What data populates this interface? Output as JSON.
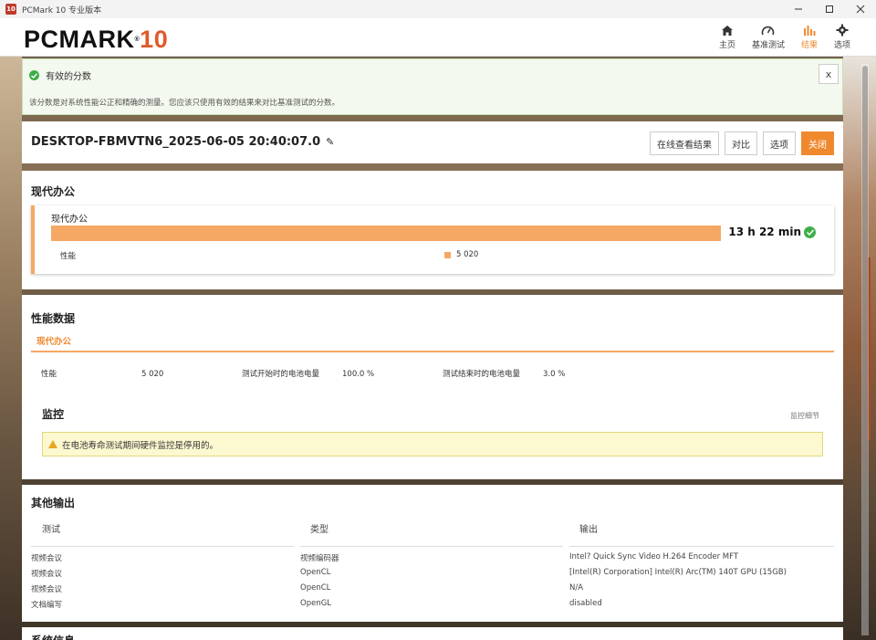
{
  "window": {
    "title": "PCMark 10 专业版本",
    "icon": "10"
  },
  "header": {
    "logo_main": "PCMARK",
    "logo_ten": "10",
    "nav": [
      {
        "label": "主页",
        "icon": "home-icon"
      },
      {
        "label": "基准测试",
        "icon": "gauge-icon"
      },
      {
        "label": "结果",
        "icon": "bar-chart-icon",
        "active": true
      },
      {
        "label": "选项",
        "icon": "gear-icon"
      }
    ]
  },
  "alert": {
    "title": "有效的分数",
    "message": "该分数是对系统性能公正和精确的测量。您应该只使用有效的结果来对比基准测试的分数。",
    "close": "x"
  },
  "result": {
    "name": "DESKTOP-FBMVTN6_2025-06-05 20:40:07.0",
    "buttons": [
      "在线查看结果",
      "对比",
      "选项",
      "关闭"
    ]
  },
  "modern_office": {
    "title": "现代办公",
    "card_label": "现代办公",
    "time": "13 h 22 min",
    "perf_label": "性能",
    "score": "5 020",
    "score_fraction": 0.83
  },
  "perf_data": {
    "title": "性能数据",
    "tab": "现代办公",
    "items": [
      {
        "label": "性能",
        "value": "5 020"
      },
      {
        "label": "测试开始时的电池电量",
        "value": "100.0 %"
      },
      {
        "label": "测试结束时的电池电量",
        "value": "3.0 %"
      }
    ],
    "monitor_title": "监控",
    "monitor_link": "监控细节",
    "warning": "在电池寿命测试期间硬件监控是停用的。"
  },
  "other_output": {
    "title": "其他输出",
    "headers": [
      "测试",
      "类型",
      "输出"
    ],
    "rows": [
      [
        "视频会议",
        "视频编码器",
        "Intel? Quick Sync Video H.264 Encoder MFT"
      ],
      [
        "视频会议",
        "OpenCL",
        "[Intel(R) Corporation] Intel(R) Arc(TM) 140T GPU (15GB)"
      ],
      [
        "视频会议",
        "OpenCL",
        "N/A"
      ],
      [
        "文档编写",
        "OpenGL",
        "disabled"
      ]
    ]
  },
  "next_section": {
    "title": "系统信息"
  },
  "colors": {
    "accent": "#f0892e",
    "bar": "#f5a864",
    "ok": "#3fae49",
    "warn": "#e9a51e"
  }
}
